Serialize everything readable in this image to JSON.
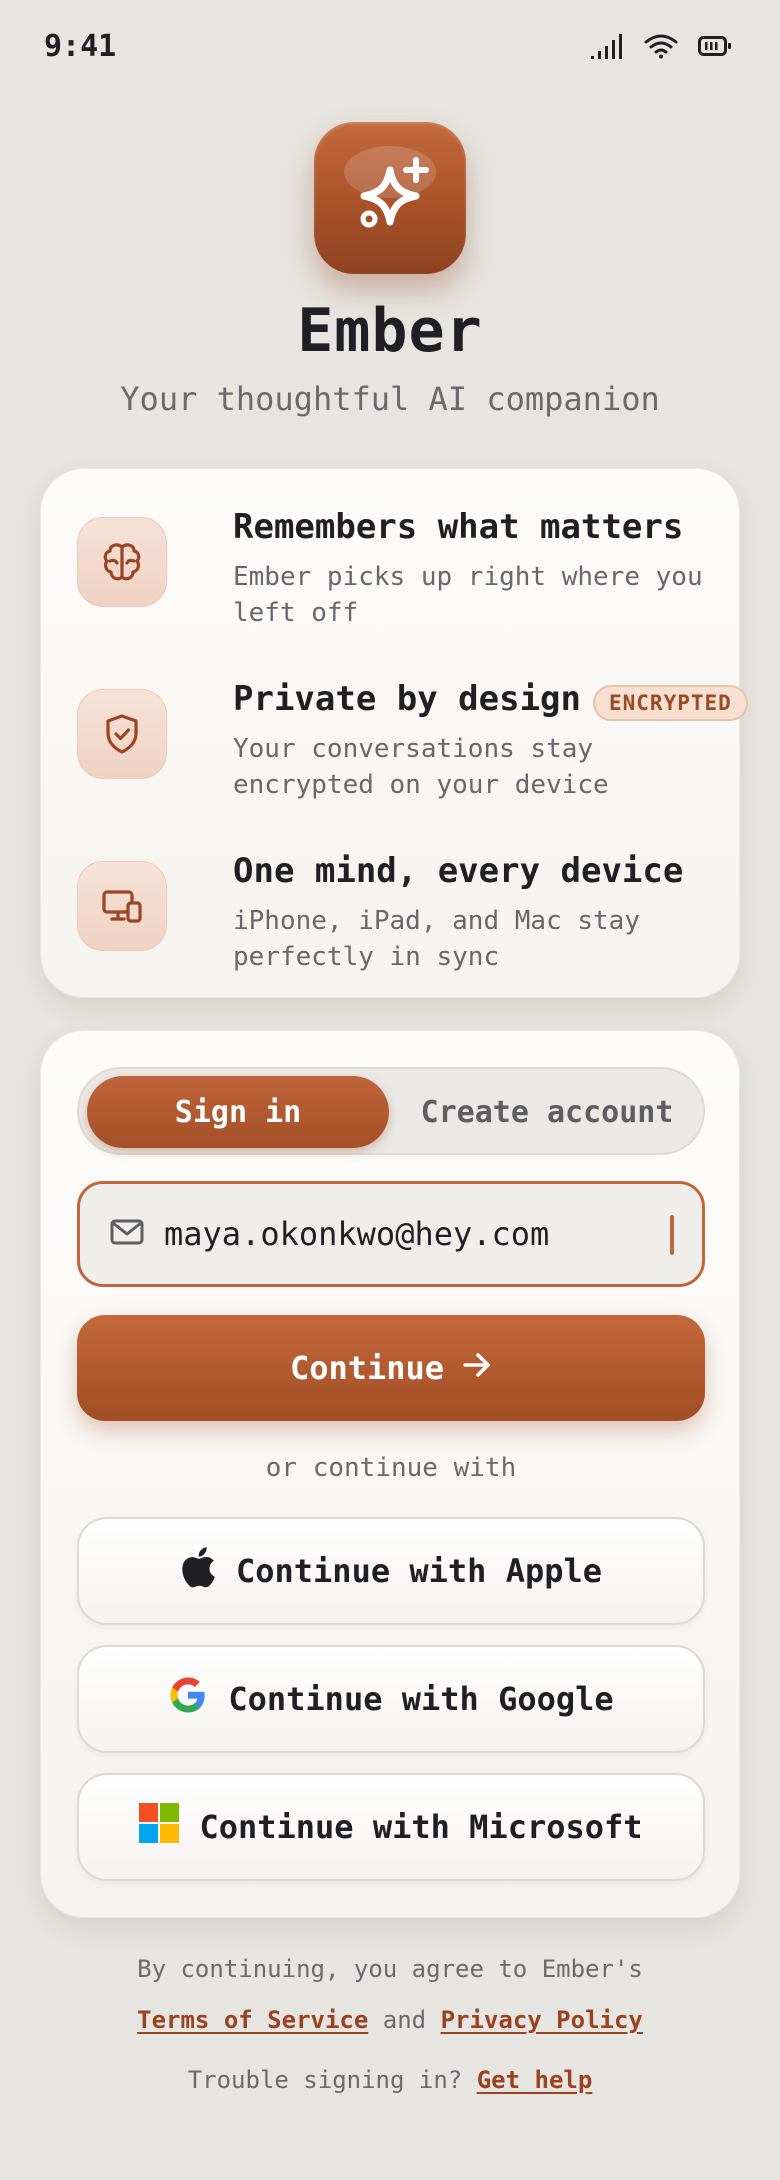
{
  "status_bar": {
    "time": "9:41",
    "icons": [
      "cellular-signal-icon",
      "wifi-icon",
      "battery-icon"
    ]
  },
  "brand": {
    "icon": "sparkle-icon",
    "title": "Ember",
    "subtitle": "Your thoughtful AI companion",
    "accent_color": "#b3582c"
  },
  "features": [
    {
      "icon": "brain-icon",
      "title": "Remembers what matters",
      "description": "Ember picks up right where you left off",
      "badge": ""
    },
    {
      "icon": "shield-check-icon",
      "title": "Private by design",
      "description": "Your conversations stay encrypted on your device",
      "badge": "ENCRYPTED"
    },
    {
      "icon": "devices-icon",
      "title": "One mind, every device",
      "description": "iPhone, iPad, and Mac stay perfectly in sync",
      "badge": ""
    }
  ],
  "auth": {
    "tabs": [
      {
        "label": "Sign in",
        "active": true
      },
      {
        "label": "Create account",
        "active": false
      }
    ],
    "email": {
      "icon": "mail-icon",
      "value": "maya.okonkwo@hey.com"
    },
    "continue_label": "Continue",
    "divider_text": "or continue with",
    "providers": [
      {
        "icon": "apple-icon",
        "label": "Continue with Apple"
      },
      {
        "icon": "google-icon",
        "label": "Continue with Google"
      },
      {
        "icon": "microsoft-icon",
        "label": "Continue with Microsoft"
      }
    ]
  },
  "legal": {
    "prefix": "By continuing, you agree to Ember's",
    "terms": "Terms of Service",
    "and": "and",
    "privacy": "Privacy Policy",
    "help_prefix": "Trouble signing in?",
    "help_link": "Get help"
  }
}
